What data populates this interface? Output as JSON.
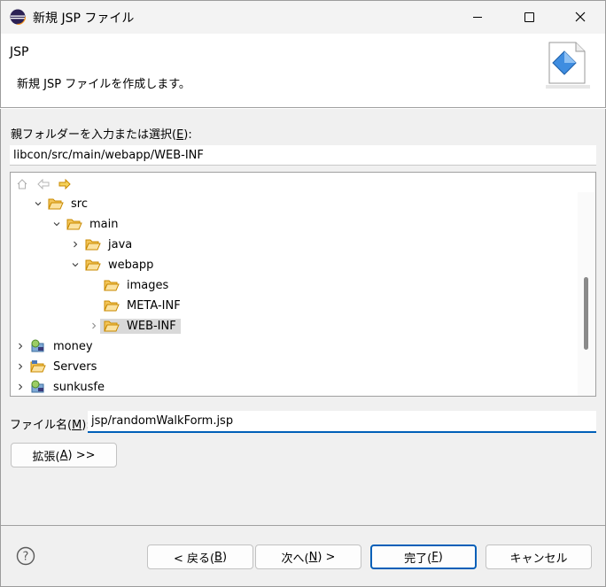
{
  "window": {
    "title": "新規 JSP ファイル",
    "minimize_glyph": "—",
    "maximize_glyph": "☐",
    "close_glyph": "✕"
  },
  "banner": {
    "title": "JSP",
    "description": "新規 JSP ファイルを作成します。"
  },
  "parent": {
    "label_pre": "親フォルダーを入力または選択(",
    "label_key": "E",
    "label_post": "):",
    "value": "libcon/src/main/webapp/WEB-INF"
  },
  "tree": {
    "items": [
      {
        "label": "src",
        "type": "folder",
        "expanded": true
      },
      {
        "label": "main",
        "type": "folder",
        "expanded": true
      },
      {
        "label": "java",
        "type": "folder",
        "expanded": false
      },
      {
        "label": "webapp",
        "type": "folder",
        "expanded": true
      },
      {
        "label": "images",
        "type": "folder"
      },
      {
        "label": "META-INF",
        "type": "folder"
      },
      {
        "label": "WEB-INF",
        "type": "folder",
        "selected": true
      },
      {
        "label": "money",
        "type": "project"
      },
      {
        "label": "Servers",
        "type": "folder-project"
      },
      {
        "label": "sunkusfe",
        "type": "project"
      }
    ]
  },
  "filename": {
    "label_pre": "ファイル名(",
    "label_key": "M",
    "label_post": "):",
    "value": "jsp/randomWalkForm.jsp"
  },
  "buttons": {
    "advanced_pre": "拡張(",
    "advanced_key": "A",
    "advanced_post": ") >>",
    "back_pre": "< 戻る(",
    "back_key": "B",
    "back_post": ")",
    "next_pre": "次へ(",
    "next_key": "N",
    "next_post": ") >",
    "finish_pre": "完了(",
    "finish_key": "F",
    "finish_post": ")",
    "cancel": "キャンセル",
    "help_glyph": "?"
  },
  "colors": {
    "accent": "#005fb8",
    "folder": "#e8a020",
    "selection": "#d9d9d9"
  }
}
